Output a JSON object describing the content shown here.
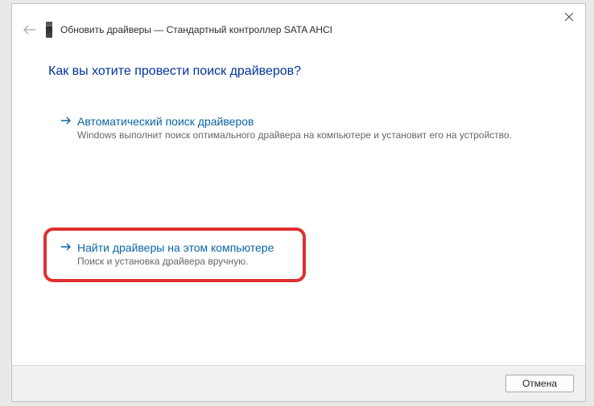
{
  "titlebar": {
    "title": "Обновить драйверы — Стандартный контроллер SATA AHCI"
  },
  "heading": "Как вы хотите провести поиск драйверов?",
  "options": {
    "auto": {
      "title": "Автоматический поиск драйверов",
      "desc": "Windows выполнит поиск оптимального драйвера на компьютере и установит его на устройство."
    },
    "browse": {
      "title": "Найти драйверы на этом компьютере",
      "desc": "Поиск и установка драйвера вручную."
    }
  },
  "footer": {
    "cancel": "Отмена"
  }
}
